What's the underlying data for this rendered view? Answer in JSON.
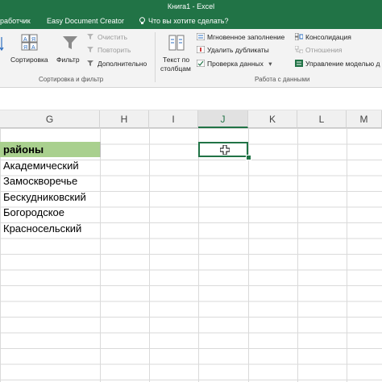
{
  "title": "Книга1 - Excel",
  "tabs": [
    "работчик",
    "Easy Document Creator",
    "Что вы хотите сделать?"
  ],
  "ribbon": {
    "sort_label": "Сортировка",
    "filter_label": "Фильтр",
    "clear_label": "Очистить",
    "reapply_label": "Повторить",
    "advanced_label": "Дополнительно",
    "text_to_columns_1": "Текст по",
    "text_to_columns_2": "столбцам",
    "flash_fill_label": "Мгновенное заполнение",
    "remove_duplicates_label": "Удалить дубликаты",
    "data_validation_label": "Проверка данных",
    "consolidate_label": "Консолидация",
    "relationships_label": "Отношения",
    "data_model_label": "Управление моделью д",
    "group_sort_filter": "Сортировка и фильтр",
    "group_data_tools": "Работа с данными"
  },
  "columns": [
    "G",
    "H",
    "I",
    "J",
    "K",
    "L",
    "M"
  ],
  "selected_column": "J",
  "cells": {
    "header": "районы",
    "rows": [
      "Академический",
      "Замоскворечье",
      "Бескудниковский",
      "Богородское",
      "Красносельский"
    ]
  },
  "colors": {
    "excel_green": "#217346",
    "header_fill": "#a9d08e"
  }
}
